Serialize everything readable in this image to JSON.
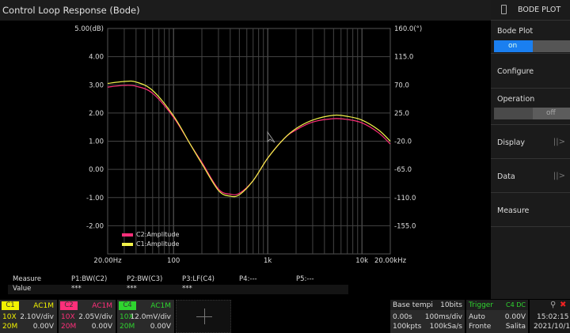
{
  "title": "Control Loop Response (Bode)",
  "panel": {
    "header": "BODE PLOT",
    "bode_plot": {
      "label": "Bode Plot",
      "state": "on"
    },
    "configure": "Configure",
    "operation": {
      "label": "Operation",
      "state": "off"
    },
    "display": "Display",
    "data": "Data",
    "measure": "Measure"
  },
  "chart_data": {
    "type": "line",
    "title": "",
    "xscale": "log",
    "xlim": [
      20,
      20000
    ],
    "x_ticks": [
      "20.00Hz",
      "100",
      "1k",
      "10k",
      "20.00kHz"
    ],
    "y_left": {
      "unit": "dB",
      "ylim": [
        -3,
        5
      ],
      "ticks": [
        "5.00(dB)",
        "4.00",
        "3.00",
        "2.00",
        "1.00",
        "0.00",
        "-1.00",
        "-2.00"
      ]
    },
    "y_right": {
      "unit": "°",
      "ticks": [
        "160.0(°)",
        "115.0",
        "70.0",
        "25.0",
        "-20.0",
        "-65.0",
        "-110.0",
        "-155.0"
      ]
    },
    "grid": true,
    "legend": "bottom-left",
    "x": [
      20,
      30,
      40,
      60,
      100,
      150,
      200,
      300,
      400,
      500,
      700,
      1000,
      1500,
      2000,
      3000,
      5000,
      7000,
      10000,
      15000,
      20000
    ],
    "series": [
      {
        "name": "C2:Amplitude",
        "color": "#ff2f7a",
        "values": [
          2.92,
          2.98,
          2.95,
          2.7,
          1.85,
          0.9,
          0.25,
          -0.7,
          -0.88,
          -0.85,
          -0.4,
          0.4,
          1.1,
          1.4,
          1.68,
          1.8,
          1.77,
          1.65,
          1.3,
          0.9
        ]
      },
      {
        "name": "C1:Amplitude",
        "color": "#f2f24a",
        "values": [
          3.05,
          3.12,
          3.1,
          2.8,
          1.9,
          0.9,
          0.2,
          -0.75,
          -0.95,
          -0.9,
          -0.4,
          0.4,
          1.1,
          1.45,
          1.75,
          1.92,
          1.88,
          1.75,
          1.4,
          1.0
        ]
      }
    ]
  },
  "measure": {
    "headers": [
      "Measure",
      "P1:BW(C2)",
      "P2:BW(C3)",
      "P3:LF(C4)",
      "P4:---",
      "P5:---"
    ],
    "values": [
      "Value",
      "***",
      "***",
      "***"
    ]
  },
  "channels": [
    {
      "name": "C1",
      "coupling": "AC1M",
      "probe": "10X",
      "scale": "2.10V/div",
      "bw": "20M",
      "offset": "0.00V",
      "color": "#f2f200"
    },
    {
      "name": "C2",
      "coupling": "AC1M",
      "probe": "10X",
      "scale": "2.05V/div",
      "bw": "20M",
      "offset": "0.00V",
      "color": "#ff2f7a"
    },
    {
      "name": "C4",
      "coupling": "AC1M",
      "probe": "10X",
      "scale": "12.0mV/div",
      "bw": "20M",
      "offset": "0.00V",
      "color": "#2fd52f"
    }
  ],
  "timebase": {
    "label": "Base tempi",
    "bits": "10bits",
    "delay": "0.00s",
    "scale": "100ms/div",
    "points": "100kpts",
    "rate": "100kSa/s"
  },
  "trigger": {
    "label": "Trigger",
    "source": "C4 DC",
    "mode": "Auto",
    "level": "0.00V",
    "edge_label": "Fronte",
    "edge": "Salita"
  },
  "clock": {
    "time": "15:02:15",
    "date": "2021/10/1"
  }
}
